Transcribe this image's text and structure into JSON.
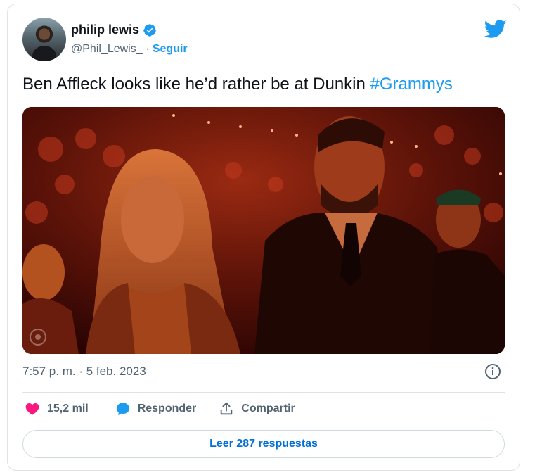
{
  "tweet": {
    "author": {
      "name": "philip lewis",
      "handle": "@Phil_Lewis_",
      "separator": " · ",
      "follow_label": "Seguir",
      "avatar_icon": "avatar",
      "verified_icon": "verified-badge-icon"
    },
    "brand_icon": "twitter-bird-icon",
    "text": "Ben Affleck looks like he’d rather be at Dunkin ",
    "hashtag": "#Grammys",
    "media": {
      "description_icon": "photo"
    },
    "timestamp": "7:57 p. m. · 5 feb. 2023",
    "info_icon": "info-icon",
    "actions": {
      "like_count": "15,2 mil",
      "reply_label": "Responder",
      "share_label": "Compartir"
    },
    "read_replies_label": "Leer 287 respuestas"
  },
  "colors": {
    "accent": "#1d9bf0",
    "like": "#f91880",
    "text": "#0f1419",
    "muted": "#536471",
    "link_button": "#006fd6"
  }
}
